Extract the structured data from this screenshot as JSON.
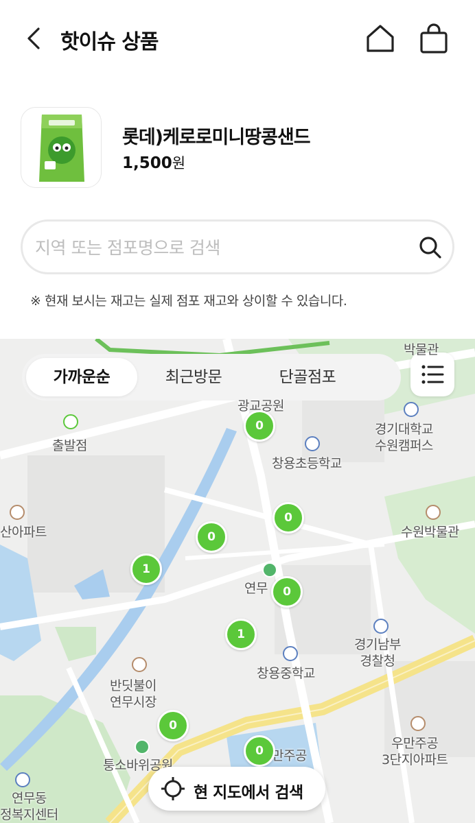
{
  "header": {
    "title": "핫이슈 상품",
    "back_icon": "chevron-left-icon",
    "home_icon": "home-icon",
    "bag_icon": "shopping-bag-icon"
  },
  "product": {
    "name": "롯데)케로로미니땅콩샌드",
    "price": "1,500",
    "price_unit": "원"
  },
  "search": {
    "placeholder": "지역 또는 점포명으로 검색",
    "value": ""
  },
  "notice": "※ 현재 보시는 재고는 실제 점포 재고와 상이할 수 있습니다.",
  "map": {
    "tabs": [
      {
        "label": "가까운순",
        "active": true
      },
      {
        "label": "최근방문",
        "active": false
      },
      {
        "label": "단골점포",
        "active": false
      }
    ],
    "markers": [
      "0",
      "0",
      "0",
      "1",
      "0",
      "1",
      "0",
      "0"
    ],
    "places": {
      "gyeonggi_univ": "경기대학교\n수원캠퍼스",
      "changyong_elem": "창용초등학교",
      "suwon_museum": "수원박물관",
      "start_point": "출발점",
      "apt_left": "산아파트",
      "yeonmu": "연무",
      "gyeonggi_police": "경기남부\n경찰청",
      "changyong_mid": "창용중학교",
      "market": "반딧불이\n연무시장",
      "umanjugong": "우만주공\n3단지아파트",
      "tongsobawi": "퉁소바위공원",
      "yeonmudong": "연무동\n정복지센터",
      "bakmulgwan_top": "박물관",
      "park_top": "광교공원",
      "manjugong": "만주공"
    },
    "search_here": "현 지도에서 검색",
    "accent_color": "#5bc83a"
  }
}
